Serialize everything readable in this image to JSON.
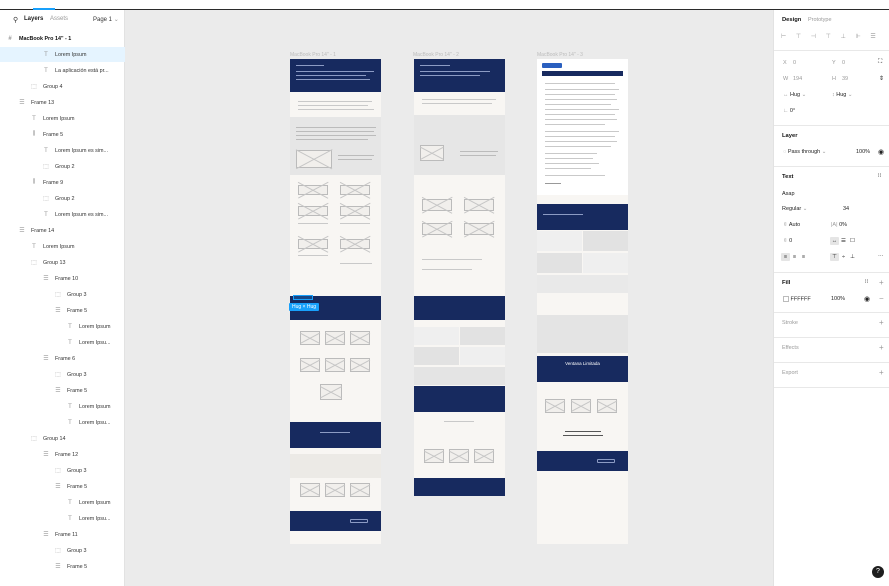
{
  "left_panel": {
    "tabs": {
      "layers": "Layers",
      "assets": "Assets",
      "page": "Page 1"
    },
    "layers": [
      {
        "icon": "#",
        "label": "MacBook Pro 14\" - 1",
        "indent": 0,
        "bold": true
      },
      {
        "icon": "T",
        "label": "Lorem Ipsum",
        "indent": 3,
        "selected": true
      },
      {
        "icon": "T",
        "label": "La aplicación está pr...",
        "indent": 3
      },
      {
        "icon": "⬚",
        "label": "Group 4",
        "indent": 2
      },
      {
        "icon": "☰",
        "label": "Frame 13",
        "indent": 1
      },
      {
        "icon": "T",
        "label": "Lorem Ipsum",
        "indent": 2
      },
      {
        "icon": "⫼",
        "label": "Frame 5",
        "indent": 2
      },
      {
        "icon": "T",
        "label": "Lorem Ipsum es sim...",
        "indent": 3
      },
      {
        "icon": "⬚",
        "label": "Group 2",
        "indent": 3
      },
      {
        "icon": "⫼",
        "label": "Frame 9",
        "indent": 2
      },
      {
        "icon": "⬚",
        "label": "Group 2",
        "indent": 3
      },
      {
        "icon": "T",
        "label": "Lorem Ipsum es sim...",
        "indent": 3
      },
      {
        "icon": "☰",
        "label": "Frame 14",
        "indent": 1
      },
      {
        "icon": "T",
        "label": "Lorem Ipsum",
        "indent": 2
      },
      {
        "icon": "⬚",
        "label": "Group 13",
        "indent": 2
      },
      {
        "icon": "☰",
        "label": "Frame 10",
        "indent": 3
      },
      {
        "icon": "⬚",
        "label": "Group 3",
        "indent": 4
      },
      {
        "icon": "☰",
        "label": "Frame 5",
        "indent": 4
      },
      {
        "icon": "T",
        "label": "Lorem Ipsum",
        "indent": 5
      },
      {
        "icon": "T",
        "label": "Lorem Ipsu...",
        "indent": 5
      },
      {
        "icon": "☰",
        "label": "Frame 6",
        "indent": 3
      },
      {
        "icon": "⬚",
        "label": "Group 3",
        "indent": 4
      },
      {
        "icon": "☰",
        "label": "Frame 5",
        "indent": 4
      },
      {
        "icon": "T",
        "label": "Lorem Ipsum",
        "indent": 5
      },
      {
        "icon": "T",
        "label": "Lorem Ipsu...",
        "indent": 5
      },
      {
        "icon": "⬚",
        "label": "Group 14",
        "indent": 2
      },
      {
        "icon": "☰",
        "label": "Frame 12",
        "indent": 3
      },
      {
        "icon": "⬚",
        "label": "Group 3",
        "indent": 4
      },
      {
        "icon": "☰",
        "label": "Frame 5",
        "indent": 4
      },
      {
        "icon": "T",
        "label": "Lorem Ipsum",
        "indent": 5
      },
      {
        "icon": "T",
        "label": "Lorem Ipsu...",
        "indent": 5
      },
      {
        "icon": "☰",
        "label": "Frame 11",
        "indent": 3
      },
      {
        "icon": "⬚",
        "label": "Group 3",
        "indent": 4
      },
      {
        "icon": "☰",
        "label": "Frame 5",
        "indent": 4
      }
    ]
  },
  "canvas": {
    "frames": [
      {
        "label": "MacBook Pro 14\" - 1"
      },
      {
        "label": "MacBook Pro 14\" - 2"
      },
      {
        "label": "MacBook Pro 14\" - 3"
      }
    ],
    "hug_badge": "Hug × Hug",
    "frame3_heading": "Ventana Limitada"
  },
  "right_panel": {
    "tabs": {
      "design": "Design",
      "prototype": "Prototype"
    },
    "x_label": "X",
    "x_value": "0",
    "y_label": "Y",
    "y_value": "0",
    "w_label": "W",
    "w_value": "194",
    "h_label": "H",
    "h_value": "39",
    "hug_w": "Hug",
    "hug_h": "Hug",
    "rotation": "0°",
    "layer_title": "Layer",
    "blend": "Pass through",
    "opacity": "100%",
    "text_title": "Text",
    "font_family": "Asap",
    "font_weight": "Regular",
    "font_size": "34",
    "line_height": "Auto",
    "letter_spacing": "0%",
    "paragraph_spacing": "0",
    "fill_title": "Fill",
    "fill_hex": "FFFFFF",
    "fill_opacity": "100%",
    "stroke_title": "Stroke",
    "effects_title": "Effects",
    "export_title": "Export",
    "help": "?"
  },
  "colors": {
    "navy": "#172a5f",
    "accent": "#18a0fb",
    "selection_bg": "#e5f4ff"
  }
}
